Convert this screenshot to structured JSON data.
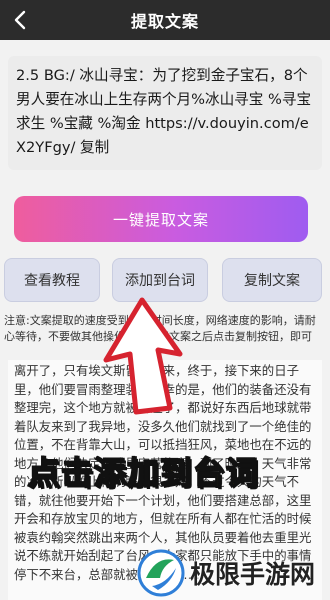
{
  "header": {
    "title": "提取文案"
  },
  "share_text": "2.5 BG:/ 冰山寻宝：为了挖到金子宝石，8个男人要在冰山上生存两个月%冰山寻宝 %寻宝求生 %宝藏 %淘金 https://v.douyin.com/eX2YFgy/ 复制",
  "extract_button": "一键提取文案",
  "actions": {
    "tutorial": "查看教程",
    "add_to_lines": "添加到台词",
    "copy": "复制文案"
  },
  "notice": "注意:文案提取的速度受到视频时间长度，网络速度的影响，请耐心等待，不要做其他操作，提取好文案之后点击复制按钮，即可",
  "article": "离开了，只有埃文斯留了下来，终于，接下来的日子里，他们要冒雨整理装备不幸的是，他们的装备还没有整理完，这个地方就被淋湿了，都说好东西后地球就带着队友来到了我异地，没多久他们就找到了一个绝佳的位置，不在背靠大山，可以抵挡狂风，菜地也在不远的地方，他们决定在这里安营扎寨，到了晚上，天气非常的冷，所以晚上他们睡得很不好，不过今天的天气不错，就往他要开始下一个计划，他们要搭建总部，这里开会和存放宝贝的地方，但就在所有人都在忙活的时候被袁约翰突然跳出来两个人，其他队员要着他去重里光说不练就开始刮起了台风，大家都只能放下手中的事情停下不来台，总部就被破坏了……",
  "overlay_caption": "点击添加到台词",
  "watermark": {
    "text": "极限手游网"
  },
  "colors": {
    "header_bg": "#2c2c2c",
    "gradient_start": "#ef5d9d",
    "gradient_end": "#9f5cf0",
    "caption": "#f5e60c",
    "arrow": "#d6232f"
  }
}
